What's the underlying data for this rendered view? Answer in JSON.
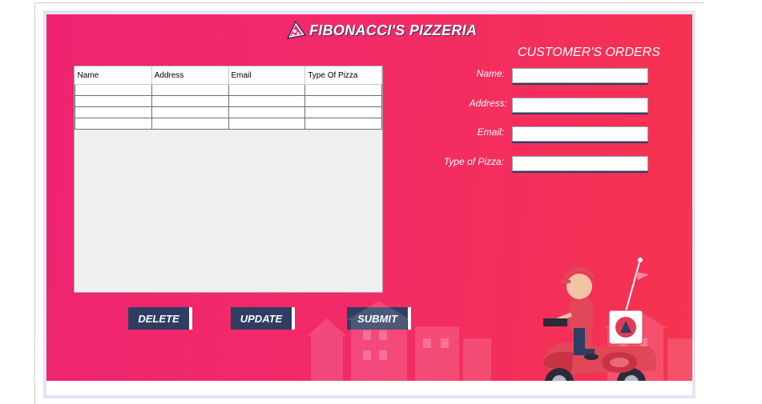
{
  "app": {
    "title": "FIBONACCI'S PIZZERIA"
  },
  "table": {
    "columns": [
      "Name",
      "Address",
      "Email",
      "Type Of Pizza"
    ],
    "rows": [
      [
        "",
        "",
        "",
        ""
      ],
      [
        "",
        "",
        "",
        ""
      ],
      [
        "",
        "",
        "",
        ""
      ],
      [
        "",
        "",
        "",
        ""
      ]
    ]
  },
  "buttons": {
    "delete": "DELETE",
    "update": "UPDATE",
    "submit": "SUBMIT"
  },
  "form": {
    "title": "CUSTOMER'S ORDERS",
    "name_label": "Name:",
    "address_label": "Address:",
    "email_label": "Email:",
    "pizza_label": "Type of Pizza:",
    "name_value": "",
    "address_value": "",
    "email_value": "",
    "pizza_value": ""
  },
  "colors": {
    "background_gradient_start": "#ee2470",
    "background_gradient_end": "#f6334f",
    "button_fill": "#2e3e63",
    "text": "#ffffff"
  },
  "icons": [
    "pizza-slice-icon",
    "delivery-scooter-illustration"
  ]
}
